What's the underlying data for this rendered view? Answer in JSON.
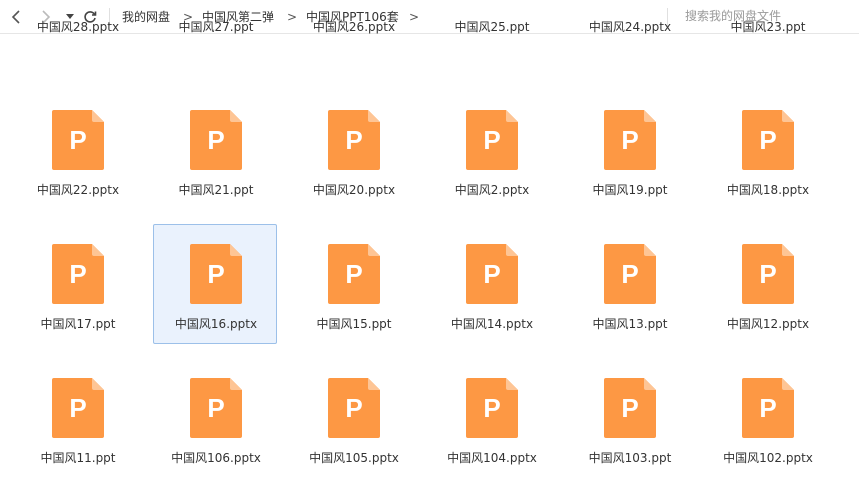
{
  "toolbar": {
    "back_icon": "chevron-left-icon",
    "forward_icon": "chevron-right-icon",
    "history_icon": "caret-down-icon",
    "refresh_icon": "refresh-icon",
    "breadcrumbs": [
      "我的网盘",
      "中国风第二弹",
      "中国风PPT106套"
    ],
    "breadcrumb_separator": ">",
    "search_placeholder": "搜索我的网盘文件"
  },
  "files": {
    "icon": "ppt-file-icon",
    "icon_letter": "P",
    "icon_color": "#fd9844",
    "icon_fold_color": "#fec595",
    "selected_index": 13,
    "items": [
      "中国风28.pptx",
      "中国风27.ppt",
      "中国风26.pptx",
      "中国风25.ppt",
      "中国风24.pptx",
      "中国风23.ppt",
      "中国风22.pptx",
      "中国风21.ppt",
      "中国风20.pptx",
      "中国风2.pptx",
      "中国风19.ppt",
      "中国风18.pptx",
      "中国风17.ppt",
      "中国风16.pptx",
      "中国风15.ppt",
      "中国风14.pptx",
      "中国风13.ppt",
      "中国风12.pptx",
      "中国风11.ppt",
      "中国风106.pptx",
      "中国风105.pptx",
      "中国风104.pptx",
      "中国风103.ppt",
      "中国风102.pptx"
    ]
  }
}
